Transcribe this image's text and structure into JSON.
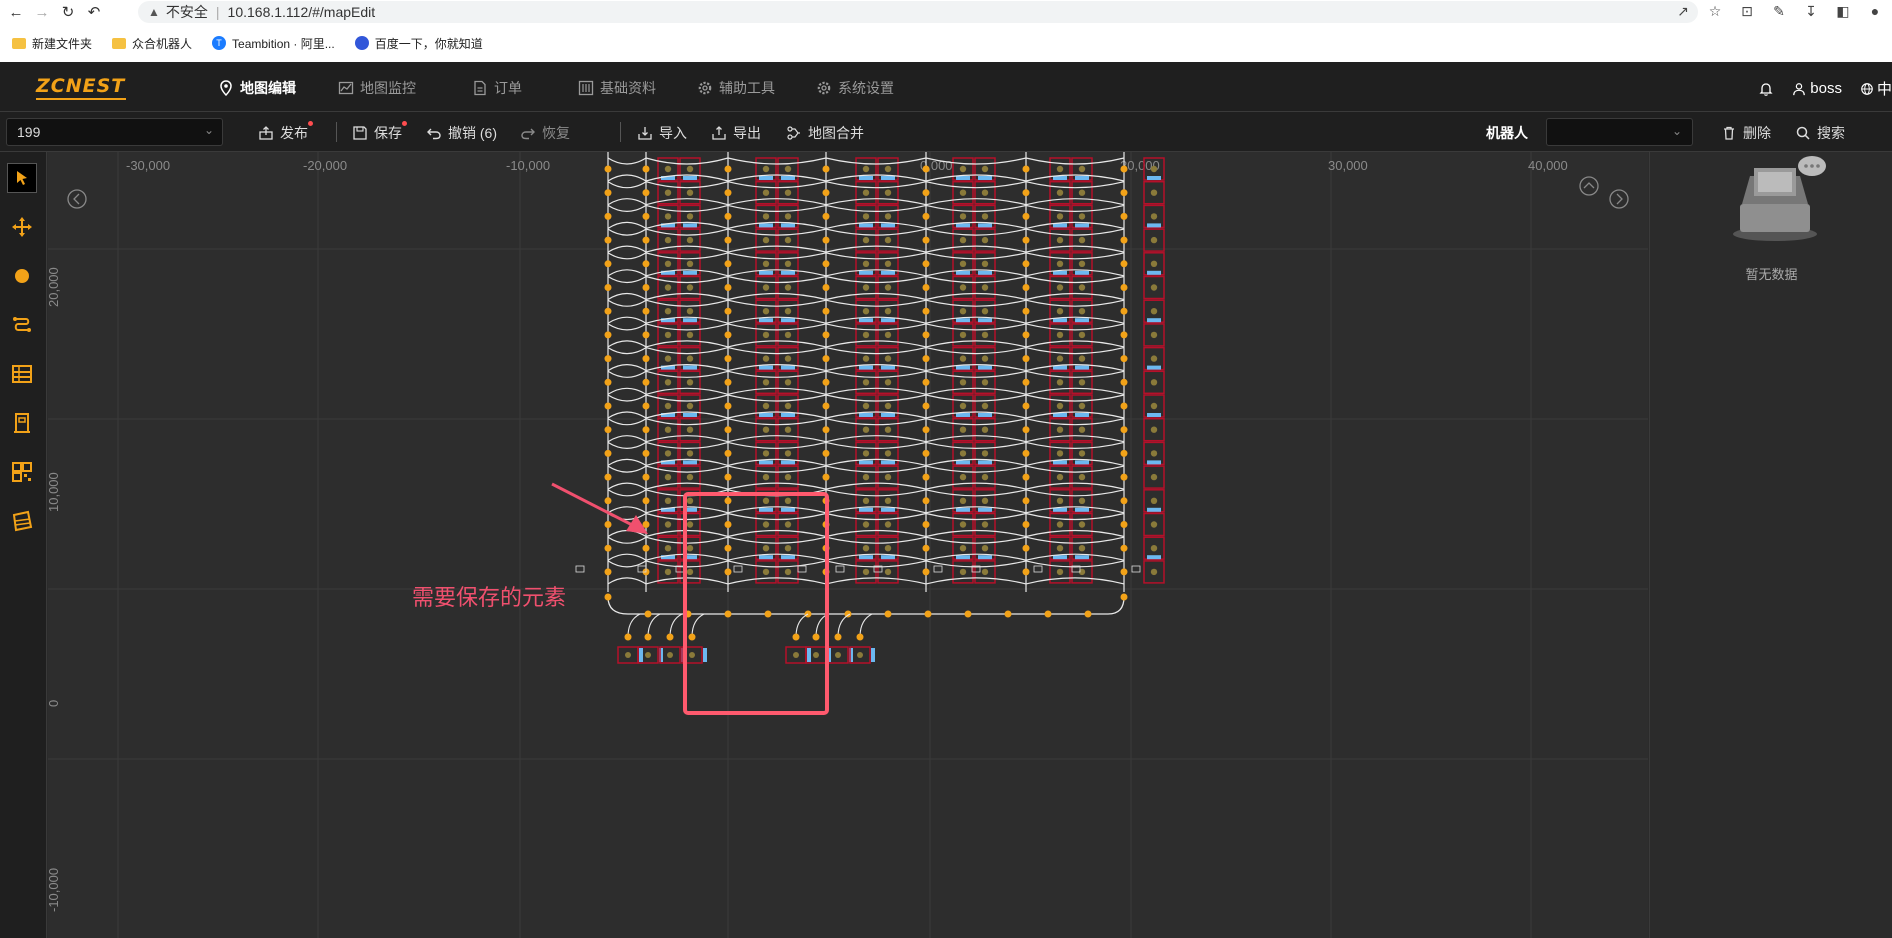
{
  "browser": {
    "security_label": "不安全",
    "url": "10.168.1.112/#/mapEdit",
    "bookmarks": [
      {
        "label": "新建文件夹",
        "icon": "folder-icon"
      },
      {
        "label": "众合机器人",
        "icon": "folder-icon"
      },
      {
        "label": "Teambition · 阿里...",
        "icon": "teambition-icon"
      },
      {
        "label": "百度一下，你就知道",
        "icon": "baidu-icon"
      }
    ]
  },
  "app": {
    "logo": "ZCNEST",
    "nav": [
      {
        "label": "地图编辑",
        "icon": "location-pin-icon",
        "active": true
      },
      {
        "label": "地图监控",
        "icon": "chart-icon",
        "active": false
      },
      {
        "label": "订单",
        "icon": "document-icon",
        "active": false
      },
      {
        "label": "基础资料",
        "icon": "sliders-icon",
        "active": false
      },
      {
        "label": "辅助工具",
        "icon": "gear-icon",
        "active": false
      },
      {
        "label": "系统设置",
        "icon": "gear-icon",
        "active": false
      }
    ],
    "user": "boss",
    "lang": "中"
  },
  "toolbar": {
    "map_id": "199",
    "publish": "发布",
    "save": "保存",
    "undo": "撤销 (6)",
    "redo": "恢复",
    "import": "导入",
    "export": "导出",
    "merge": "地图合并",
    "robot_label": "机器人",
    "robot_value": "",
    "delete": "删除",
    "search": "搜索"
  },
  "canvas": {
    "x_ticks": [
      "-30,000",
      "-20,000",
      "-10,000",
      "0,000",
      "20,000",
      "30,000",
      "40,000"
    ],
    "y_ticks": [
      "20,000",
      "10,000",
      "0",
      "-10,000"
    ],
    "annotation_text": "需要保存的元素",
    "highlight_color": "#ff5a6e",
    "node_color": "#f2a218",
    "cell_color": "#b5102a",
    "marker_color": "#6cb8f0"
  },
  "side_panel": {
    "empty_text": "暂无数据"
  }
}
